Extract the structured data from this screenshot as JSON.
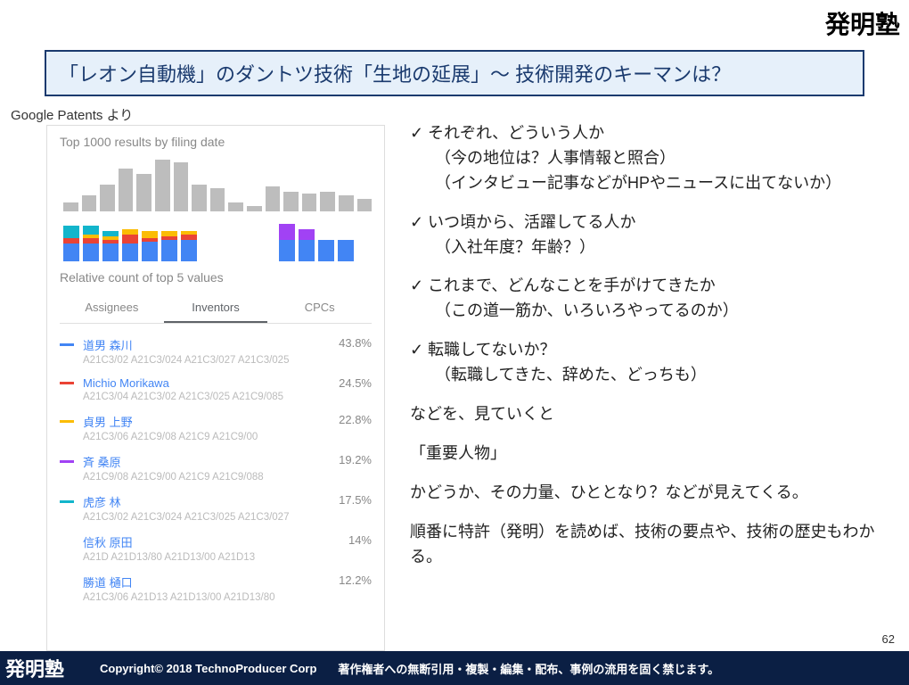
{
  "brand": "発明塾",
  "title": "「レオン自動機」のダントツ技術「生地の延展」～ 技術開発のキーマンは？",
  "source": "Google Patents より",
  "panel": {
    "title": "Top 1000 results by filing date",
    "rel_label": "Relative count of top 5 values",
    "tabs": [
      "Assignees",
      "Inventors",
      "CPCs"
    ],
    "active_tab": 1,
    "inventors": [
      {
        "name": "道男 森川",
        "pct": "43.8%",
        "color": "#4285f4",
        "codes": "A21C3/02 A21C3/024 A21C3/027 A21C3/025"
      },
      {
        "name": "Michio Morikawa",
        "pct": "24.5%",
        "color": "#ea4335",
        "codes": "A21C3/04 A21C3/02 A21C3/025 A21C9/085"
      },
      {
        "name": "貞男 上野",
        "pct": "22.8%",
        "color": "#fbbc04",
        "codes": "A21C3/06 A21C9/08 A21C9 A21C9/00"
      },
      {
        "name": "斉 桑原",
        "pct": "19.2%",
        "color": "#a142f4",
        "codes": "A21C9/08 A21C9/00 A21C9 A21C9/088"
      },
      {
        "name": "虎彦 林",
        "pct": "17.5%",
        "color": "#12b5cb",
        "codes": "A21C3/02 A21C3/024 A21C3/025 A21C3/027"
      },
      {
        "name": "信秋 原田",
        "pct": "14%",
        "color": "",
        "codes": "A21D A21D13/80 A21D13/00 A21D13"
      },
      {
        "name": "勝道 樋口",
        "pct": "12.2%",
        "color": "",
        "codes": "A21C3/06 A21D13 A21D13/00 A21D13/80"
      }
    ]
  },
  "chart_data": [
    {
      "type": "bar",
      "title": "Top 1000 results by filing date",
      "categories": [
        "",
        "",
        "",
        "",
        "",
        "",
        "",
        "",
        "",
        "",
        "",
        "",
        "",
        "",
        ""
      ],
      "values": [
        10,
        18,
        30,
        48,
        42,
        58,
        55,
        30,
        26,
        10,
        6,
        28,
        22,
        20,
        22,
        18,
        14
      ],
      "xlabel": "",
      "ylabel": "",
      "ylim": [
        0,
        60
      ]
    },
    {
      "type": "bar",
      "title": "Relative count of top 5 values (stacked)",
      "categories": [
        "",
        "",
        "",
        "",
        "",
        "",
        "",
        "",
        "",
        "",
        "",
        "",
        "",
        "",
        ""
      ],
      "series": [
        {
          "name": "道男 森川",
          "color": "#4285f4",
          "values": [
            20,
            20,
            20,
            20,
            22,
            24,
            24,
            0,
            0,
            0,
            0,
            24,
            24,
            24,
            24
          ]
        },
        {
          "name": "Michio Morikawa",
          "color": "#ea4335",
          "values": [
            6,
            6,
            4,
            10,
            4,
            4,
            6,
            0,
            0,
            0,
            0,
            0,
            0,
            0,
            0
          ]
        },
        {
          "name": "貞男 上野",
          "color": "#fbbc04",
          "values": [
            0,
            4,
            4,
            6,
            8,
            6,
            4,
            0,
            0,
            0,
            0,
            0,
            0,
            0,
            0
          ]
        },
        {
          "name": "斉 桑原",
          "color": "#a142f4",
          "values": [
            0,
            0,
            0,
            0,
            0,
            0,
            0,
            0,
            0,
            0,
            0,
            18,
            12,
            0,
            0
          ]
        },
        {
          "name": "虎彦 林",
          "color": "#12b5cb",
          "values": [
            14,
            10,
            6,
            0,
            0,
            0,
            0,
            0,
            0,
            0,
            0,
            0,
            0,
            0,
            0
          ]
        }
      ],
      "xlabel": "",
      "ylabel": ""
    }
  ],
  "bullets": {
    "b1": "それぞれ、どういう人か",
    "b1s1": "（今の地位は？人事情報と照合）",
    "b1s2": "（インタビュー記事などがHPやニュースに出てないか）",
    "b2": "いつ頃から、活躍してる人か",
    "b2s1": "（入社年度？年齢？）",
    "b3": "これまで、どんなことを手がけてきたか",
    "b3s1": "（この道一筋か、いろいろやってるのか）",
    "b4": "転職してないか？",
    "b4s1": "（転職してきた、辞めた、どっちも）",
    "p5": "などを、見ていくと",
    "p6": "「重要人物」",
    "p7": "かどうか、その力量、ひととなり？などが見えてくる。",
    "p8": "順番に特許（発明）を読めば、技術の要点や、技術の歴史もわかる。"
  },
  "footer": {
    "brand": "発明塾",
    "copy": "Copyright© 2018 TechnoProducer Corp",
    "note": "著作権者への無断引用・複製・編集・配布、事例の流用を固く禁じます。"
  },
  "page": "62"
}
